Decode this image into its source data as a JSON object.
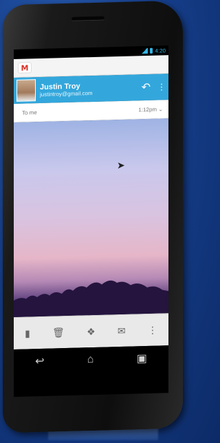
{
  "status_bar": {
    "time": "4:20"
  },
  "gmail": {
    "logo_letter": "M"
  },
  "message": {
    "sender_name": "Justin Troy",
    "sender_email": "justintroy@gmail.com",
    "to_label": "To me",
    "time": "1:12pm"
  },
  "colors": {
    "header_blue": "#33a7dc",
    "status_blue": "#33b5e5"
  }
}
